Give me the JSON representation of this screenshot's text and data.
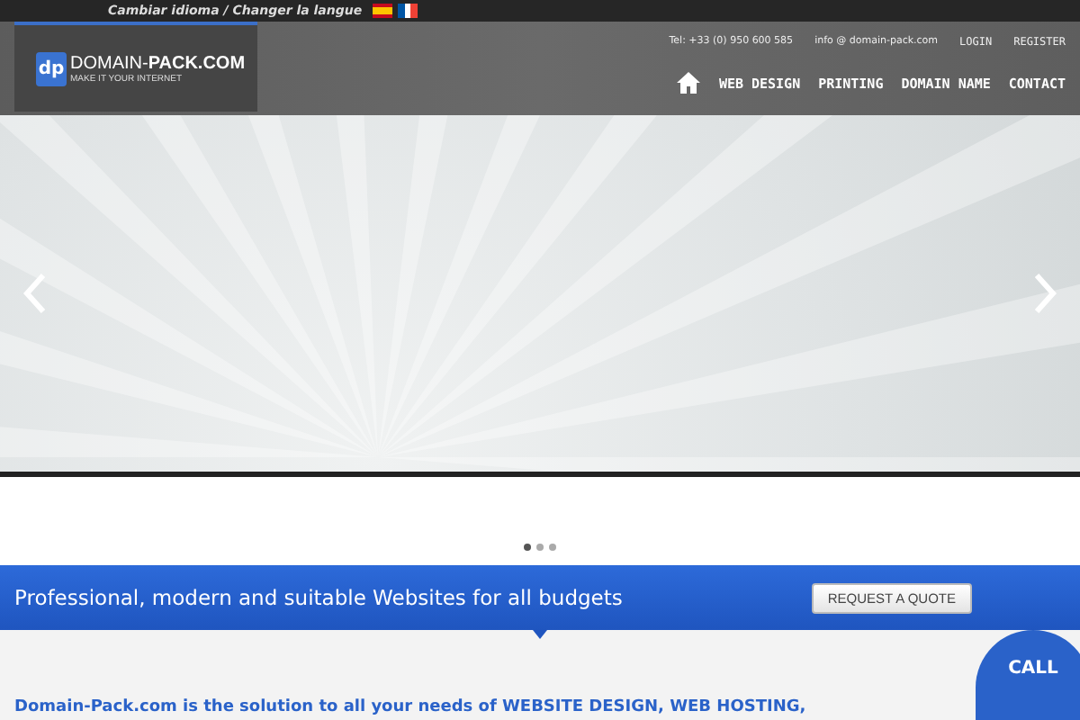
{
  "topbar": {
    "language_label": "Cambiar idioma / Changer la langue"
  },
  "logo": {
    "name_part1": "DOMAIN-",
    "name_part2": "PACK.COM",
    "tagline": "MAKE IT YOUR INTERNET",
    "mark": "dp"
  },
  "contact": {
    "phone": "Tel: +33 (0) 950 600 585",
    "email": "info @ domain-pack.com"
  },
  "account_links": [
    "LOGIN",
    "REGISTER"
  ],
  "nav": [
    {
      "label": "WEB DESIGN"
    },
    {
      "label": "PRINTING"
    },
    {
      "label": "DOMAIN NAME"
    },
    {
      "label": "CONTACT"
    }
  ],
  "slider": {
    "dots": [
      {
        "selected": true
      },
      {
        "selected": false
      },
      {
        "selected": false
      }
    ]
  },
  "banner": {
    "text": "Professional, modern and suitable Websites for all budgets",
    "button": "REQUEST A QUOTE"
  },
  "intro": {
    "text": "Domain-Pack.com is the solution to all your needs of WEBSITE DESIGN, WEB HOSTING,"
  },
  "call_badge": "CALL"
}
